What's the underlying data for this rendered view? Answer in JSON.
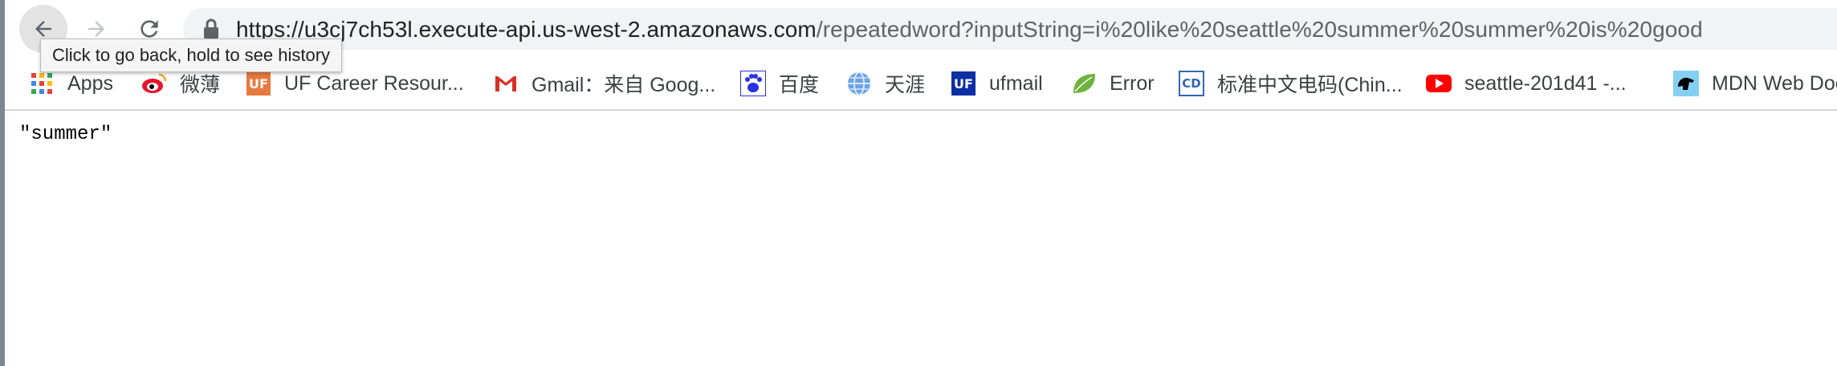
{
  "browser": {
    "tooltip": "Click to go back, hold to see history",
    "url_host": "https://u3cj7ch53l.execute-api.us-west-2.amazonaws.com",
    "url_path": "/repeatedword?inputString=i%20like%20seattle%20summer%20summer%20is%20good",
    "icons": {
      "back": "arrow-left-icon",
      "forward": "arrow-right-icon",
      "reload": "reload-icon",
      "secure": "lock-icon"
    }
  },
  "bookmarks": [
    {
      "label": "Apps",
      "icon": "apps-grid-icon"
    },
    {
      "label": "微薄",
      "icon": "weibo-icon"
    },
    {
      "label": "UF Career Resour...",
      "icon": "uf-career-icon"
    },
    {
      "label": "Gmail：来自 Goog...",
      "icon": "gmail-icon"
    },
    {
      "label": "百度",
      "icon": "baidu-paw-icon"
    },
    {
      "label": "天涯",
      "icon": "globe-icon"
    },
    {
      "label": "ufmail",
      "icon": "uf-icon"
    },
    {
      "label": "Error",
      "icon": "leaf-icon"
    },
    {
      "label": "标准中文电码(Chin...",
      "icon": "cd-icon"
    },
    {
      "label": "seattle-201d41 -...",
      "icon": "youtube-icon"
    },
    {
      "label": "MDN Web Docs",
      "icon": "mdn-dino-icon"
    }
  ],
  "page": {
    "response_text": "\"summer\""
  }
}
